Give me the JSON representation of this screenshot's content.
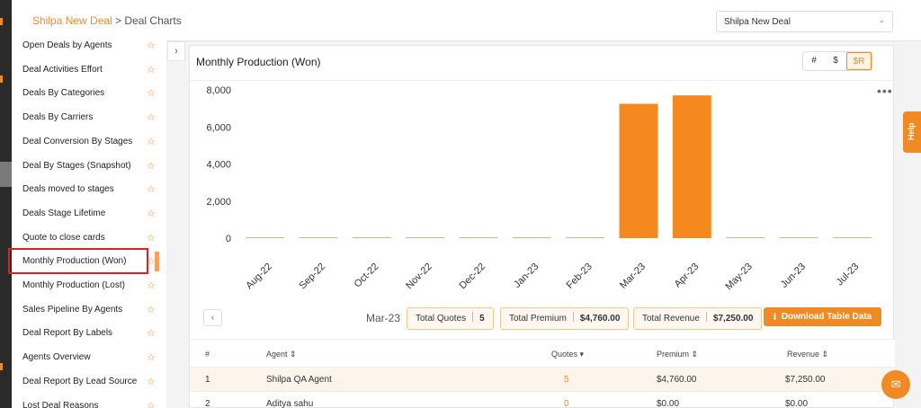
{
  "breadcrumb": {
    "link": "Shilpa New Deal",
    "separator": " > ",
    "current": "Deal Charts"
  },
  "deal_select": {
    "value": "Shilpa New Deal"
  },
  "sidebar": {
    "items": [
      {
        "label": "Open Deals by Agents"
      },
      {
        "label": "Deal Activities Effort"
      },
      {
        "label": "Deals By Categories"
      },
      {
        "label": "Deals By Carriers"
      },
      {
        "label": "Deal Conversion By Stages"
      },
      {
        "label": "Deal By Stages (Snapshot)"
      },
      {
        "label": "Deals moved to stages"
      },
      {
        "label": "Deals Stage Lifetime"
      },
      {
        "label": "Quote to close cards"
      },
      {
        "label": "Monthly Production (Won)",
        "active": true
      },
      {
        "label": "Monthly Production (Lost)"
      },
      {
        "label": "Sales Pipeline By Agents"
      },
      {
        "label": "Deal Report By Labels"
      },
      {
        "label": "Agents Overview"
      },
      {
        "label": "Deal Report By Lead Source"
      },
      {
        "label": "Lost Deal Reasons"
      }
    ]
  },
  "panel": {
    "title": "Monthly Production (Won)",
    "toggles": [
      {
        "label": "#",
        "active": false
      },
      {
        "label": "$",
        "active": false
      },
      {
        "label": "$R",
        "active": true
      }
    ]
  },
  "chart_data": {
    "type": "bar",
    "categories": [
      "Aug-22",
      "Sep-22",
      "Oct-22",
      "Nov-22",
      "Dec-22",
      "Jan-23",
      "Feb-23",
      "Mar-23",
      "Apr-23",
      "May-23",
      "Jun-23",
      "Jul-23"
    ],
    "values": [
      0,
      0,
      0,
      0,
      0,
      0,
      0,
      7250,
      7700,
      0,
      0,
      0
    ],
    "ylim": [
      0,
      8000
    ],
    "yticks": [
      "0",
      "2,000",
      "4,000",
      "6,000",
      "8,000"
    ],
    "bar_color": "#f5891f"
  },
  "summary": {
    "month": "Mar-23",
    "stats": [
      {
        "label": "Total Quotes",
        "value": "5"
      },
      {
        "label": "Total Premium",
        "value": "$4,760.00"
      },
      {
        "label": "Total Revenue",
        "value": "$7,250.00"
      }
    ],
    "download_label": "Download Table Data"
  },
  "table": {
    "headers": {
      "num": "#",
      "agent": "Agent ⇕",
      "quotes": "Quotes ▾",
      "premium": "Premium ⇕",
      "revenue": "Revenue ⇕"
    },
    "rows": [
      {
        "num": "1",
        "agent": "Shilpa QA Agent",
        "quotes": "5",
        "premium": "$4,760.00",
        "revenue": "$7,250.00"
      },
      {
        "num": "2",
        "agent": "Aditya sahu",
        "quotes": "0",
        "premium": "$0.00",
        "revenue": "$0.00"
      }
    ]
  },
  "help": {
    "label": "Help"
  },
  "colors": {
    "accent": "#f08a24",
    "highlight_border": "#e02020"
  }
}
